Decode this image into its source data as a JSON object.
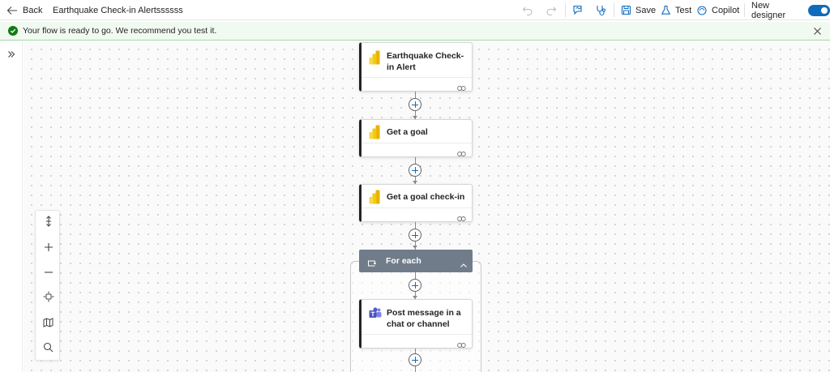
{
  "toolbar": {
    "back_label": "Back",
    "flow_title": "Earthquake Check-in Alertssssss",
    "save_label": "Save",
    "test_label": "Test",
    "copilot_label": "Copilot",
    "new_designer_label": "New designer",
    "new_designer_on": true,
    "icons": [
      "back-arrow-icon",
      "undo-icon",
      "redo-icon",
      "feedback-icon",
      "flow-checker-icon",
      "save-icon",
      "test-flask-icon",
      "copilot-icon"
    ]
  },
  "notification": {
    "text": "Your flow is ready to go. We recommend you test it.",
    "status_color": "#107c10"
  },
  "zoom_controls": [
    "fit-height-icon",
    "zoom-in-icon",
    "zoom-out-icon",
    "center-view-icon",
    "minimap-icon",
    "search-icon"
  ],
  "flow": {
    "steps": [
      {
        "title": "Earthquake Check-in Alert",
        "icon": "power-bi-icon"
      },
      {
        "title": "Get a goal",
        "icon": "power-bi-icon"
      },
      {
        "title": "Get a goal check-in",
        "icon": "power-bi-icon"
      }
    ],
    "loop": {
      "title": "For each",
      "color": "#707c89",
      "steps": [
        {
          "title": "Post message in a chat or channel",
          "icon": "teams-icon"
        }
      ]
    }
  },
  "colors": {
    "accent": "#0f6cbd",
    "success": "#107c10",
    "notice_bg": "#f1faf1"
  }
}
